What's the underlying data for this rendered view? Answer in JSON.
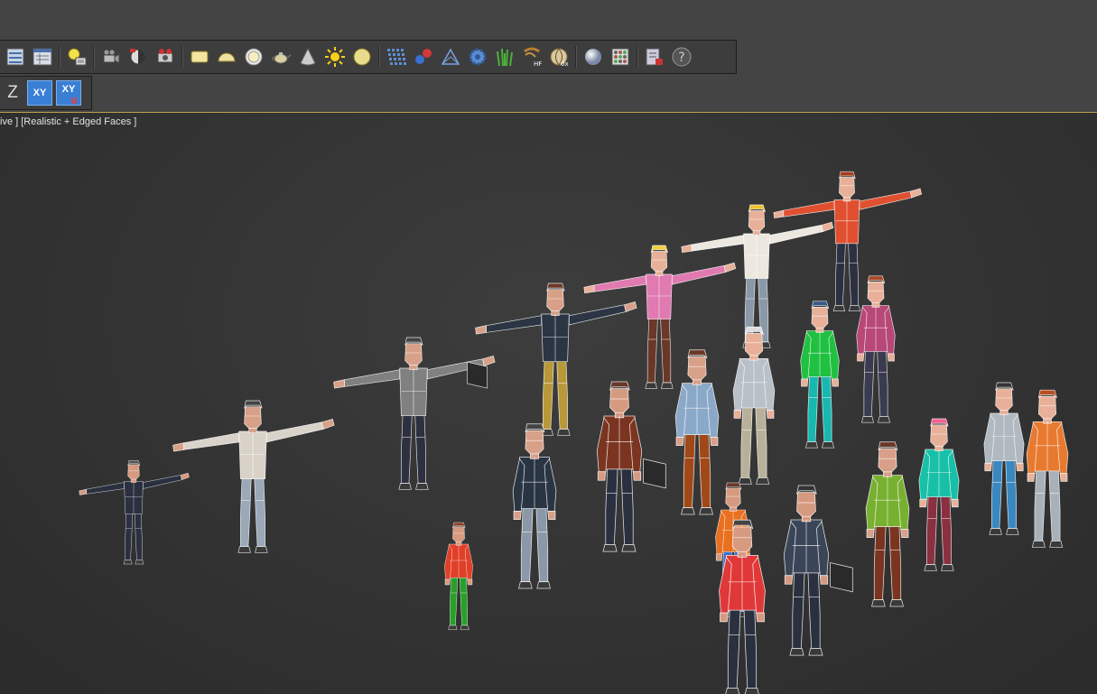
{
  "toolbar": {
    "buttons": [
      {
        "name": "layer-manager-icon"
      },
      {
        "name": "scene-explorer-icon"
      },
      {
        "sep": true
      },
      {
        "name": "light-lister-icon"
      },
      {
        "sep": true
      },
      {
        "name": "camera-icon"
      },
      {
        "name": "render-setup-icon"
      },
      {
        "name": "render-production-icon"
      },
      {
        "sep": true
      },
      {
        "name": "plane-icon"
      },
      {
        "name": "hemisphere-icon"
      },
      {
        "name": "ring-icon"
      },
      {
        "name": "teapot-icon"
      },
      {
        "name": "cone-icon"
      },
      {
        "name": "sun-icon"
      },
      {
        "name": "sphere-icon"
      },
      {
        "sep": true
      },
      {
        "name": "grid-array-icon"
      },
      {
        "name": "molecule-icon"
      },
      {
        "name": "scatter-icon"
      },
      {
        "name": "gear-icon"
      },
      {
        "name": "grass-icon"
      },
      {
        "name": "hair-fur-icon",
        "text": "HF"
      },
      {
        "name": "pattern-icon",
        "text": "0x"
      },
      {
        "sep": true
      },
      {
        "name": "material-sphere-icon"
      },
      {
        "name": "material-editor-icon"
      },
      {
        "sep": true
      },
      {
        "name": "render-frame-icon"
      },
      {
        "name": "help-icon"
      }
    ]
  },
  "toolbar2": {
    "axis_z": "Z",
    "axis_xy": "XY",
    "axis_xy_snap": "XY"
  },
  "viewport": {
    "label": "ive ] [Realistic + Edged Faces ]"
  },
  "colors": {
    "accent_blue": "#3a7fd6",
    "viewport_border": "#b8a24a"
  }
}
